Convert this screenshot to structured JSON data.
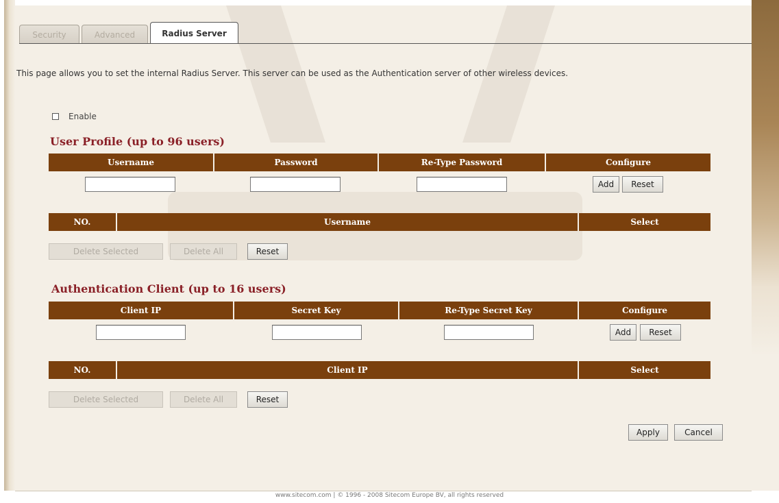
{
  "tabs": [
    {
      "label": "Security"
    },
    {
      "label": "Advanced"
    },
    {
      "label": "Radius Server"
    }
  ],
  "intro": "This page allows you to set the internal Radius Server. This server can be used as the Authentication server of other wireless devices.",
  "enable_label": "Enable",
  "user_profile": {
    "title": "User Profile (up to 96 users)",
    "headers": [
      "Username",
      "Password",
      "Re-Type Password",
      "Configure"
    ],
    "username_value": "",
    "password_value": "",
    "retype_value": "",
    "add_label": "Add",
    "reset_label": "Reset",
    "list_headers": [
      "NO.",
      "Username",
      "Select"
    ],
    "delete_selected_label": "Delete Selected",
    "delete_all_label": "Delete All",
    "list_reset_label": "Reset"
  },
  "auth_client": {
    "title": "Authentication Client (up to 16 users)",
    "headers": [
      "Client IP",
      "Secret Key",
      "Re-Type Secret Key",
      "Configure"
    ],
    "client_ip_value": "",
    "secret_value": "",
    "retype_secret_value": "",
    "add_label": "Add",
    "reset_label": "Reset",
    "list_headers": [
      "NO.",
      "Client IP",
      "Select"
    ],
    "delete_selected_label": "Delete Selected",
    "delete_all_label": "Delete All",
    "list_reset_label": "Reset"
  },
  "apply_label": "Apply",
  "cancel_label": "Cancel",
  "footer": "www.sitecom.com | © 1996 - 2008 Sitecom Europe BV, all rights reserved",
  "colors": {
    "header_bg": "#7a400d",
    "section_title": "#8a2027",
    "panel_bg": "#f4efe6"
  }
}
